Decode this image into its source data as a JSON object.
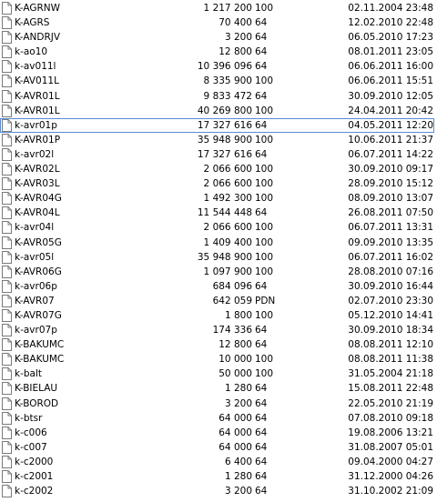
{
  "rows": [
    {
      "name": "K-AGRNW",
      "type": "100",
      "size": "1 217 200",
      "date": "02.11.2004 23:48"
    },
    {
      "name": "K-AGRS",
      "type": "64",
      "size": "70 400",
      "date": "12.02.2010 22:48"
    },
    {
      "name": "K-ANDRJV",
      "type": "64",
      "size": "3 200",
      "date": "06.05.2010 17:23"
    },
    {
      "name": "k-ao10",
      "type": "64",
      "size": "12 800",
      "date": "08.01.2011 23:05"
    },
    {
      "name": "k-av011l",
      "type": "64",
      "size": "10 396 096",
      "date": "06.06.2011 16:00"
    },
    {
      "name": "K-AV011L",
      "type": "100",
      "size": "8 335 900",
      "date": "06.06.2011 15:51"
    },
    {
      "name": "K-AVR01L",
      "type": "64",
      "size": "9 833 472",
      "date": "30.09.2010 12:05"
    },
    {
      "name": "K-AVR01L",
      "type": "100",
      "size": "40 269 800",
      "date": "24.04.2011 20:42"
    },
    {
      "name": "k-avr01p",
      "type": "64",
      "size": "17 327 616",
      "date": "04.05.2011 12:20",
      "selected": true
    },
    {
      "name": "K-AVR01P",
      "type": "100",
      "size": "35 948 900",
      "date": "10.06.2011 21:37"
    },
    {
      "name": "k-avr02l",
      "type": "64",
      "size": "17 327 616",
      "date": "06.07.2011 14:22"
    },
    {
      "name": "K-AVR02L",
      "type": "100",
      "size": "2 066 600",
      "date": "30.09.2010 09:17"
    },
    {
      "name": "K-AVR03L",
      "type": "100",
      "size": "2 066 600",
      "date": "28.09.2010 15:12"
    },
    {
      "name": "K-AVR04G",
      "type": "100",
      "size": "1 492 300",
      "date": "08.09.2010 13:07"
    },
    {
      "name": "K-AVR04L",
      "type": "64",
      "size": "11 544 448",
      "date": "26.08.2011 07:50"
    },
    {
      "name": "k-avr04l",
      "type": "100",
      "size": "2 066 600",
      "date": "06.07.2011 13:31"
    },
    {
      "name": "K-AVR05G",
      "type": "100",
      "size": "1 409 400",
      "date": "09.09.2010 13:35"
    },
    {
      "name": "k-avr05l",
      "type": "100",
      "size": "35 948 900",
      "date": "06.07.2011 16:02"
    },
    {
      "name": "K-AVR06G",
      "type": "100",
      "size": "1 097 900",
      "date": "28.08.2010 07:16"
    },
    {
      "name": "k-avr06p",
      "type": "64",
      "size": "684 096",
      "date": "30.09.2010 16:44"
    },
    {
      "name": "K-AVR07",
      "type": "PDN",
      "size": "642 059",
      "date": "02.07.2010 23:30"
    },
    {
      "name": "K-AVR07G",
      "type": "100",
      "size": "1 800",
      "date": "05.12.2010 14:41"
    },
    {
      "name": "k-avr07p",
      "type": "64",
      "size": "174 336",
      "date": "30.09.2010 18:34"
    },
    {
      "name": "K-BAKUMC",
      "type": "64",
      "size": "12 800",
      "date": "08.08.2011 12:10"
    },
    {
      "name": "K-BAKUMC",
      "type": "100",
      "size": "10 000",
      "date": "08.08.2011 11:38"
    },
    {
      "name": "k-balt",
      "type": "100",
      "size": "50 000",
      "date": "31.05.2004 21:18"
    },
    {
      "name": "K-BIELAU",
      "type": "64",
      "size": "1 280",
      "date": "15.08.2011 22:48"
    },
    {
      "name": "K-BOROD",
      "type": "64",
      "size": "3 200",
      "date": "22.05.2010 21:19"
    },
    {
      "name": "k-btsr",
      "type": "64",
      "size": "64 000",
      "date": "07.08.2010 09:18"
    },
    {
      "name": "k-c006",
      "type": "64",
      "size": "64 000",
      "date": "19.08.2006 13:21"
    },
    {
      "name": "k-c007",
      "type": "64",
      "size": "64 000",
      "date": "31.08.2007 05:01"
    },
    {
      "name": "k-c2000",
      "type": "64",
      "size": "6 400",
      "date": "09.04.2000 04:27"
    },
    {
      "name": "k-c2001",
      "type": "64",
      "size": "1 280",
      "date": "31.12.2000 04:26"
    },
    {
      "name": "k-c2002",
      "type": "64",
      "size": "3 200",
      "date": "31.10.2002 21:09"
    }
  ]
}
